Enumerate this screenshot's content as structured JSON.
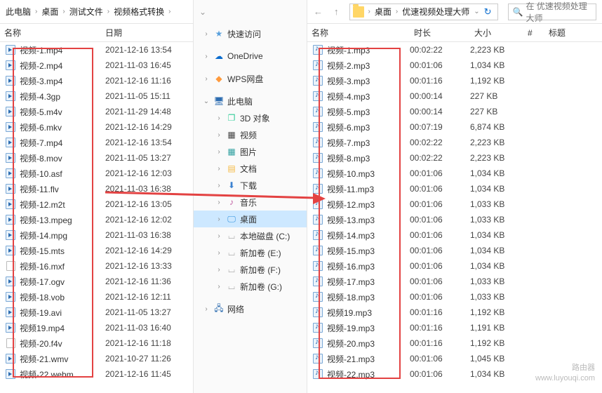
{
  "left_pane": {
    "breadcrumb": [
      "此电脑",
      "桌面",
      "测试文件",
      "视频格式转换"
    ],
    "columns": {
      "name": "名称",
      "date": "日期"
    },
    "files": [
      {
        "name": "视频-1.mp4",
        "date": "2021-12-16 13:54",
        "type": "vid"
      },
      {
        "name": "视频-2.mp4",
        "date": "2021-11-03 16:45",
        "type": "vid"
      },
      {
        "name": "视频-3.mp4",
        "date": "2021-12-16 11:16",
        "type": "vid"
      },
      {
        "name": "视频-4.3gp",
        "date": "2021-11-05 15:11",
        "type": "vid"
      },
      {
        "name": "视频-5.m4v",
        "date": "2021-11-29 14:48",
        "type": "vid"
      },
      {
        "name": "视频-6.mkv",
        "date": "2021-12-16 14:29",
        "type": "vid"
      },
      {
        "name": "视频-7.mp4",
        "date": "2021-12-16 13:54",
        "type": "vid"
      },
      {
        "name": "视频-8.mov",
        "date": "2021-11-05 13:27",
        "type": "vid"
      },
      {
        "name": "视频-10.asf",
        "date": "2021-12-16 12:03",
        "type": "vid"
      },
      {
        "name": "视频-11.flv",
        "date": "2021-11-03 16:38",
        "type": "vid"
      },
      {
        "name": "视频-12.m2t",
        "date": "2021-12-16 13:05",
        "type": "vid"
      },
      {
        "name": "视频-13.mpeg",
        "date": "2021-12-16 12:02",
        "type": "vid"
      },
      {
        "name": "视频-14.mpg",
        "date": "2021-11-03 16:38",
        "type": "vid"
      },
      {
        "name": "视频-15.mts",
        "date": "2021-12-16 14:29",
        "type": "vid"
      },
      {
        "name": "视频-16.mxf",
        "date": "2021-12-16 13:33",
        "type": "doc"
      },
      {
        "name": "视频-17.ogv",
        "date": "2021-12-16 11:36",
        "type": "vid"
      },
      {
        "name": "视频-18.vob",
        "date": "2021-12-16 12:11",
        "type": "vid"
      },
      {
        "name": "视频-19.avi",
        "date": "2021-11-05 13:27",
        "type": "vid"
      },
      {
        "name": "视频19.mp4",
        "date": "2021-11-03 16:40",
        "type": "vid"
      },
      {
        "name": "视频-20.f4v",
        "date": "2021-12-16 11:18",
        "type": "doc"
      },
      {
        "name": "视频-21.wmv",
        "date": "2021-10-27 11:26",
        "type": "vid"
      },
      {
        "name": "视频-22.webm",
        "date": "2021-12-16 11:45",
        "type": "vid"
      }
    ]
  },
  "tree": {
    "items": [
      {
        "label": "快速访问",
        "icon": "star-icon",
        "cls": "c-star",
        "glyph": "★",
        "level": 1,
        "expand": ">"
      },
      {
        "label": "OneDrive",
        "icon": "cloud-icon",
        "cls": "c-cloud",
        "glyph": "☁",
        "level": 1,
        "expand": ">",
        "spacer": true
      },
      {
        "label": "WPS网盘",
        "icon": "wps-icon",
        "cls": "c-wps",
        "glyph": "◆",
        "level": 1,
        "expand": ">",
        "spacer": true
      },
      {
        "label": "此电脑",
        "icon": "computer-icon",
        "cls": "c-pc",
        "glyph": "🖥",
        "level": 1,
        "expand": "v",
        "spacer": true
      },
      {
        "label": "3D 对象",
        "icon": "cube-icon",
        "cls": "c-3d",
        "glyph": "❐",
        "level": 2,
        "expand": ">"
      },
      {
        "label": "视频",
        "icon": "video-folder-icon",
        "cls": "c-vid2",
        "glyph": "▦",
        "level": 2,
        "expand": ">"
      },
      {
        "label": "图片",
        "icon": "pictures-folder-icon",
        "cls": "c-pic",
        "glyph": "▦",
        "level": 2,
        "expand": ">"
      },
      {
        "label": "文档",
        "icon": "documents-folder-icon",
        "cls": "c-docf",
        "glyph": "▤",
        "level": 2,
        "expand": ">"
      },
      {
        "label": "下载",
        "icon": "downloads-folder-icon",
        "cls": "c-dl",
        "glyph": "⬇",
        "level": 2,
        "expand": ">"
      },
      {
        "label": "音乐",
        "icon": "music-folder-icon",
        "cls": "c-mus",
        "glyph": "♪",
        "level": 2,
        "expand": ">"
      },
      {
        "label": "桌面",
        "icon": "desktop-icon",
        "cls": "c-desk",
        "glyph": "🖵",
        "level": 2,
        "expand": ">",
        "selected": true
      },
      {
        "label": "本地磁盘 (C:)",
        "icon": "disk-icon",
        "cls": "c-disk",
        "glyph": "⌴",
        "level": 2,
        "expand": ">"
      },
      {
        "label": "新加卷 (E:)",
        "icon": "disk-icon",
        "cls": "c-disk",
        "glyph": "⌴",
        "level": 2,
        "expand": ">"
      },
      {
        "label": "新加卷 (F:)",
        "icon": "disk-icon",
        "cls": "c-disk",
        "glyph": "⌴",
        "level": 2,
        "expand": ">"
      },
      {
        "label": "新加卷 (G:)",
        "icon": "disk-icon",
        "cls": "c-disk",
        "glyph": "⌴",
        "level": 2,
        "expand": ">"
      },
      {
        "label": "网络",
        "icon": "network-icon",
        "cls": "c-net",
        "glyph": "🖧",
        "level": 1,
        "expand": ">",
        "spacer": true
      }
    ]
  },
  "right_pane": {
    "breadcrumb": [
      "桌面",
      "优速视频处理大师"
    ],
    "search_placeholder": "在 优速视频处理大师",
    "columns": {
      "name": "名称",
      "duration": "时长",
      "size": "大小",
      "num": "#",
      "title": "标题"
    },
    "files": [
      {
        "name": "视频-1.mp3",
        "duration": "00:02:22",
        "size": "2,223 KB"
      },
      {
        "name": "视频-2.mp3",
        "duration": "00:01:06",
        "size": "1,034 KB"
      },
      {
        "name": "视频-3.mp3",
        "duration": "00:01:16",
        "size": "1,192 KB"
      },
      {
        "name": "视频-4.mp3",
        "duration": "00:00:14",
        "size": "227 KB"
      },
      {
        "name": "视频-5.mp3",
        "duration": "00:00:14",
        "size": "227 KB"
      },
      {
        "name": "视频-6.mp3",
        "duration": "00:07:19",
        "size": "6,874 KB"
      },
      {
        "name": "视频-7.mp3",
        "duration": "00:02:22",
        "size": "2,223 KB"
      },
      {
        "name": "视频-8.mp3",
        "duration": "00:02:22",
        "size": "2,223 KB"
      },
      {
        "name": "视频-10.mp3",
        "duration": "00:01:06",
        "size": "1,034 KB"
      },
      {
        "name": "视频-11.mp3",
        "duration": "00:01:06",
        "size": "1,034 KB"
      },
      {
        "name": "视频-12.mp3",
        "duration": "00:01:06",
        "size": "1,033 KB"
      },
      {
        "name": "视频-13.mp3",
        "duration": "00:01:06",
        "size": "1,033 KB"
      },
      {
        "name": "视频-14.mp3",
        "duration": "00:01:06",
        "size": "1,034 KB"
      },
      {
        "name": "视频-15.mp3",
        "duration": "00:01:06",
        "size": "1,034 KB"
      },
      {
        "name": "视频-16.mp3",
        "duration": "00:01:06",
        "size": "1,034 KB"
      },
      {
        "name": "视频-17.mp3",
        "duration": "00:01:06",
        "size": "1,033 KB"
      },
      {
        "name": "视频-18.mp3",
        "duration": "00:01:06",
        "size": "1,033 KB"
      },
      {
        "name": "视频19.mp3",
        "duration": "00:01:16",
        "size": "1,192 KB"
      },
      {
        "name": "视频-19.mp3",
        "duration": "00:01:16",
        "size": "1,191 KB"
      },
      {
        "name": "视频-20.mp3",
        "duration": "00:01:16",
        "size": "1,192 KB"
      },
      {
        "name": "视频-21.mp3",
        "duration": "00:01:06",
        "size": "1,045 KB"
      },
      {
        "name": "视频-22.mp3",
        "duration": "00:01:06",
        "size": "1,034 KB"
      }
    ]
  },
  "watermark": {
    "line1": "路由器",
    "line2": "www.luyouqi.com"
  }
}
